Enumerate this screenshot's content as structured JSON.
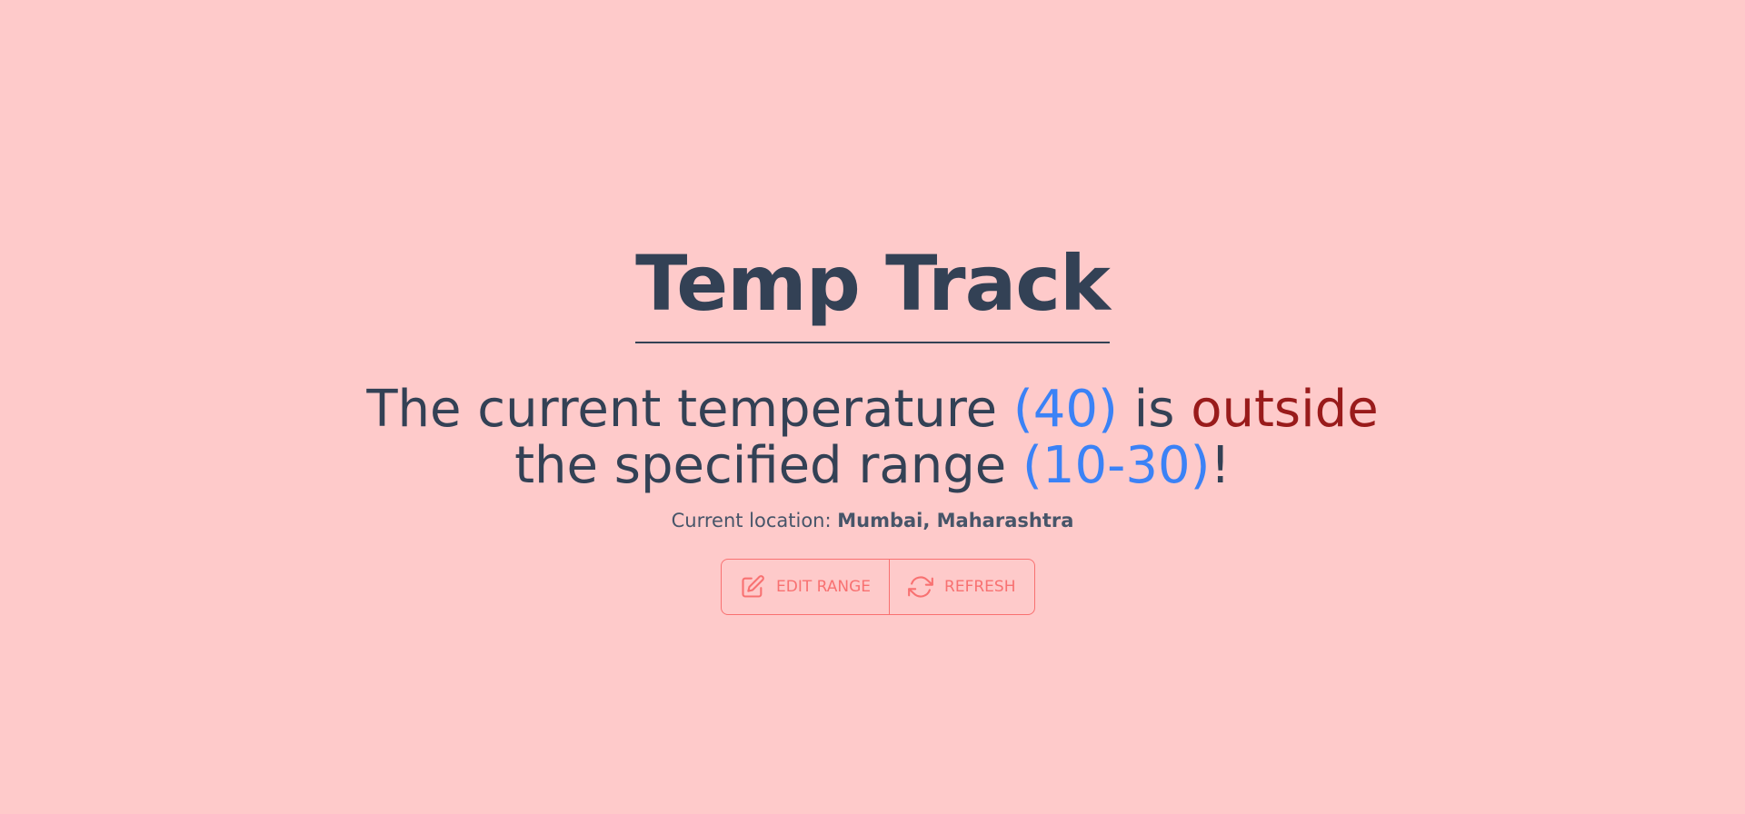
{
  "app": {
    "title": "Temp Track"
  },
  "status": {
    "prefix": "The current temperature ",
    "temperature": "(40)",
    "middle": " is ",
    "state": "outside",
    "line2_prefix": "the specified range ",
    "range": "(10-30)",
    "suffix": "!"
  },
  "location": {
    "label": "Current location: ",
    "value": "Mumbai, Maharashtra"
  },
  "actions": {
    "edit_label": "EDIT RANGE",
    "edit_icon": "edit-icon",
    "refresh_label": "REFRESH",
    "refresh_icon": "refresh-icon"
  },
  "colors": {
    "background": "#fecaca",
    "text": "#334155",
    "value": "#3b82f6",
    "alert": "#991b1b",
    "button": "#f87171"
  }
}
